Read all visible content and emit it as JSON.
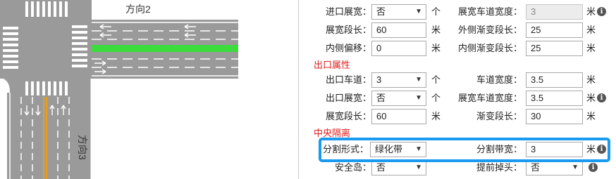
{
  "diagram": {
    "dir2_label": "方向2",
    "dir3_label": "方向3"
  },
  "sections": {
    "exit": "出口属性",
    "median": "中央隔离"
  },
  "rows": {
    "entry_widen": {
      "label": "进口展宽：",
      "value": "否",
      "unit": "个"
    },
    "widen_lane_width": {
      "label": "展宽车道宽度：",
      "value": "3",
      "unit": "米"
    },
    "widen_length": {
      "label": "展宽段长：",
      "value": "60",
      "unit": "米"
    },
    "outer_taper": {
      "label": "外侧渐变段长：",
      "value": "25",
      "unit": "米"
    },
    "inner_offset": {
      "label": "内侧偏移：",
      "value": "0",
      "unit": "米"
    },
    "inner_taper": {
      "label": "内侧渐变段长：",
      "value": "25",
      "unit": "米"
    },
    "exit_lanes": {
      "label": "出口车道：",
      "value": "3",
      "unit": "个"
    },
    "lane_width": {
      "label": "车道宽度：",
      "value": "3.5",
      "unit": "米"
    },
    "exit_widen": {
      "label": "出口展宽：",
      "value": "否",
      "unit": "个"
    },
    "exit_widen_lane_width": {
      "label": "展宽车道宽度：",
      "value": "3.5",
      "unit": "米"
    },
    "exit_widen_length": {
      "label": "展宽段长：",
      "value": "60",
      "unit": "米"
    },
    "taper_length": {
      "label": "渐变段长：",
      "value": "30",
      "unit": "米"
    },
    "divider_form": {
      "label": "分割形式：",
      "value": "绿化带"
    },
    "divider_width": {
      "label": "分割带宽：",
      "value": "3",
      "unit": "米"
    },
    "safety_island": {
      "label": "安全岛：",
      "value": "否"
    },
    "early_uturn": {
      "label": "提前掉头：",
      "value": "否"
    }
  },
  "colors": {
    "highlight": "#1a9bef",
    "section": "#e02020",
    "green_belt": "#3ddc3d",
    "road": "#9a9a9a"
  }
}
